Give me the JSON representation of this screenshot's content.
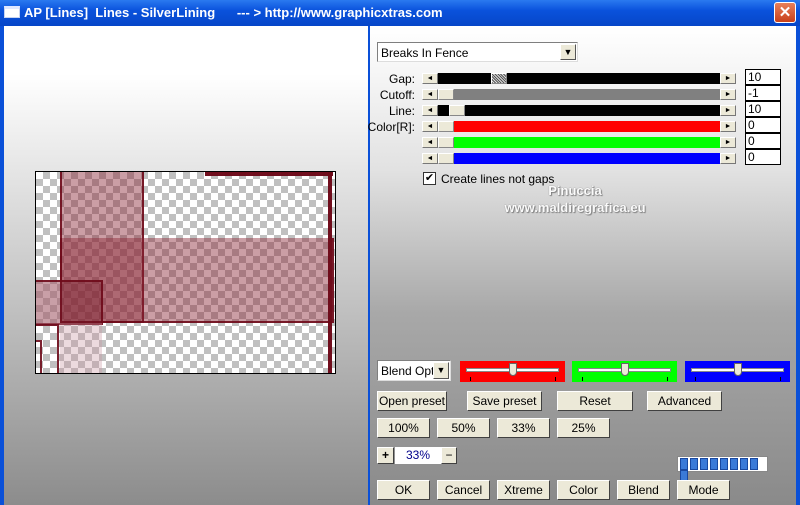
{
  "window": {
    "title": "AP [Lines]  Lines - SilverLining      --- > http://www.graphicxtras.com",
    "close_label": "✕"
  },
  "preset_select": {
    "value": "Breaks In Fence"
  },
  "sliders": [
    {
      "label": "Gap:",
      "value": "10",
      "position": 0.2
    },
    {
      "label": "Cutoff:",
      "value": "-1",
      "position": 0.0
    },
    {
      "label": "Line:",
      "value": "10",
      "position": 0.04
    },
    {
      "label": "Color[R]:",
      "value": "0",
      "position": 0.0,
      "color": "#ff0000"
    },
    {
      "label": "",
      "value": "0",
      "position": 0.0,
      "color": "#00ff00"
    },
    {
      "label": "",
      "value": "0",
      "position": 0.0,
      "color": "#0000ff"
    }
  ],
  "checkbox": {
    "label": "Create lines not gaps",
    "checked": true
  },
  "watermark": {
    "line1": "Pinuccia",
    "line2": "www.maldiregrafica.eu"
  },
  "blend_select": {
    "value": "Blend Opti"
  },
  "color_sliders": [
    {
      "color": "#ff0000",
      "position": 0.5
    },
    {
      "color": "#00ff00",
      "position": 0.5
    },
    {
      "color": "#0000ff",
      "position": 0.5
    }
  ],
  "buttons": {
    "open_preset": "Open preset",
    "save_preset": "Save preset",
    "reset": "Reset",
    "advanced": "Advanced",
    "z100": "100%",
    "z50": "50%",
    "z33": "33%",
    "z25": "25%",
    "ok": "OK",
    "cancel": "Cancel",
    "xtreme": "Xtreme",
    "color": "Color",
    "blend": "Blend",
    "mode": "Mode"
  },
  "zoom": {
    "plus": "+",
    "value": "33%",
    "minus": "−"
  },
  "progress": {
    "blocks": 9
  }
}
